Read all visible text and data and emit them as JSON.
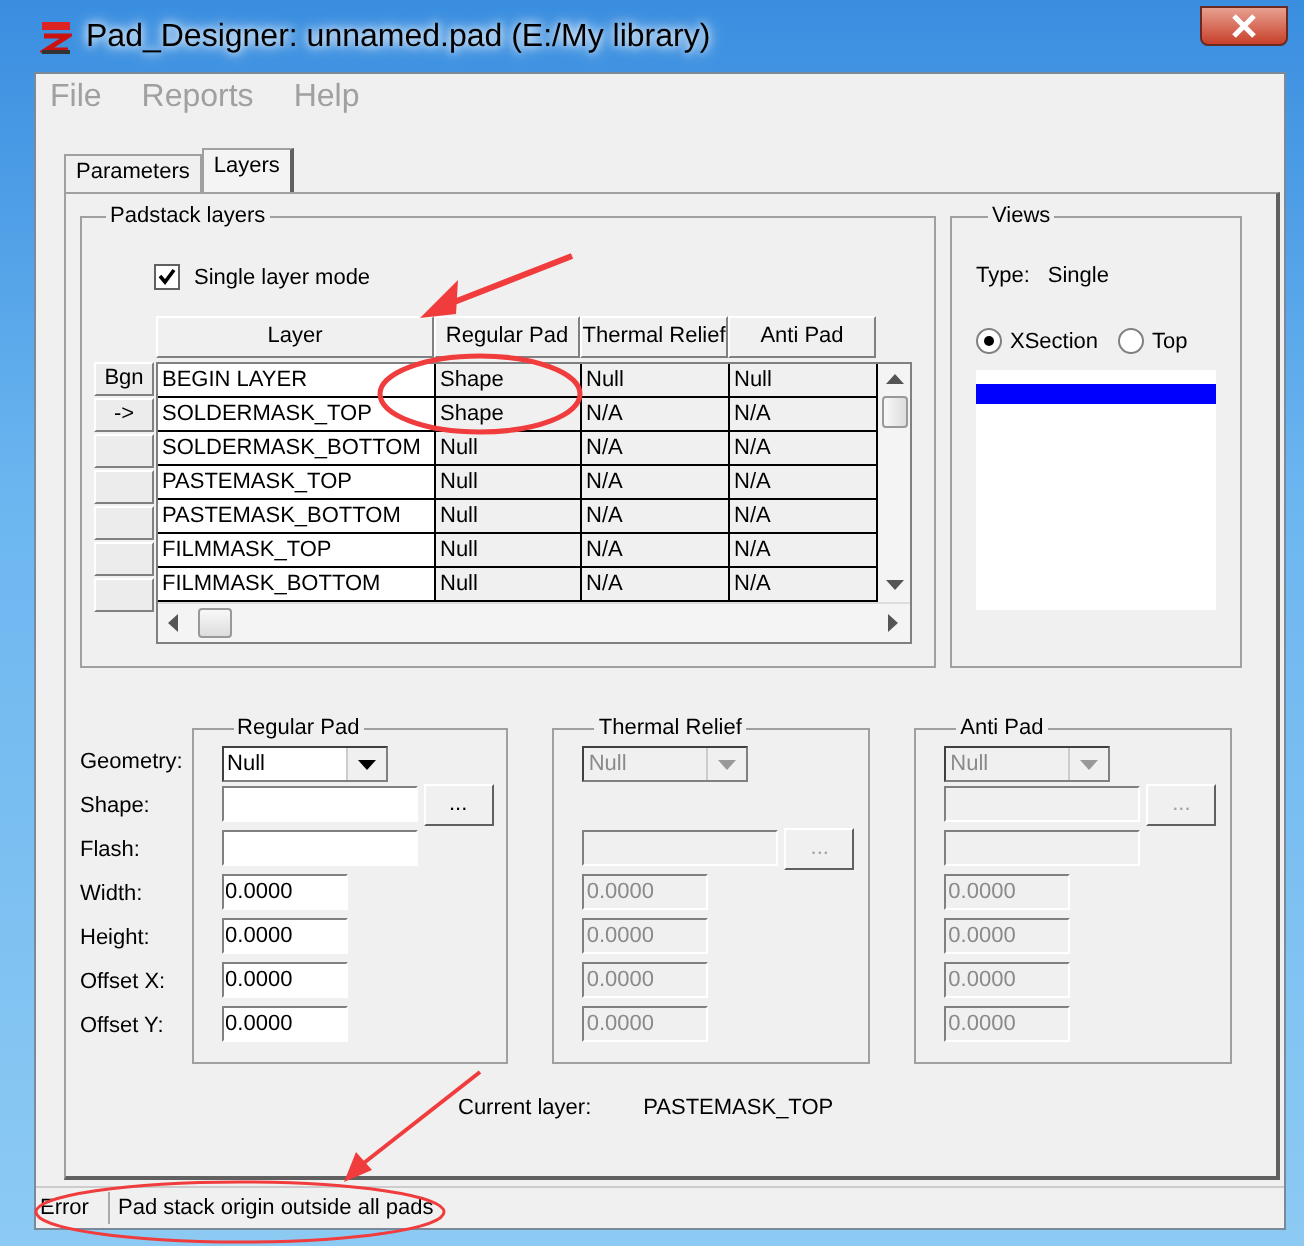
{
  "window": {
    "title": "Pad_Designer: unnamed.pad (E:/My library)"
  },
  "menu": [
    {
      "label": "File"
    },
    {
      "label": "Reports"
    },
    {
      "label": "Help"
    }
  ],
  "tabs": [
    {
      "label": "Parameters",
      "selected": false
    },
    {
      "label": "Layers",
      "selected": true
    }
  ],
  "padstack_layers": {
    "title": "Padstack layers",
    "single_layer_mode": {
      "label": "Single layer mode",
      "checked": true
    },
    "table": {
      "columns": [
        "Layer",
        "Regular Pad",
        "Thermal Relief",
        "Anti Pad"
      ],
      "rows": [
        {
          "marker": "Bgn",
          "cells": [
            "BEGIN LAYER",
            "Shape",
            "Null",
            "Null"
          ]
        },
        {
          "marker": "->",
          "cells": [
            "SOLDERMASK_TOP",
            "Shape",
            "N/A",
            "N/A"
          ]
        },
        {
          "cells": [
            "SOLDERMASK_BOTTOM",
            "Null",
            "N/A",
            "N/A"
          ]
        },
        {
          "cells": [
            "PASTEMASK_TOP",
            "Null",
            "N/A",
            "N/A"
          ]
        },
        {
          "cells": [
            "PASTEMASK_BOTTOM",
            "Null",
            "N/A",
            "N/A"
          ]
        },
        {
          "cells": [
            "FILMMASK_TOP",
            "Null",
            "N/A",
            "N/A"
          ]
        },
        {
          "cells": [
            "FILMMASK_BOTTOM",
            "Null",
            "N/A",
            "N/A"
          ]
        }
      ]
    }
  },
  "views": {
    "title": "Views",
    "type_label": "Type:",
    "type_value": "Single",
    "options": [
      {
        "label": "XSection",
        "selected": true
      },
      {
        "label": "Top",
        "selected": false
      }
    ]
  },
  "field_labels": [
    "Geometry:",
    "Shape:",
    "Flash:",
    "Width:",
    "Height:",
    "Offset X:",
    "Offset Y:"
  ],
  "pad_groups": [
    {
      "title": "Regular Pad",
      "disabled": false,
      "geometry": "Null",
      "fields": [
        {
          "kind": "text",
          "browse": "..."
        },
        {
          "kind": "text"
        },
        {
          "kind": "number",
          "value": "0.0000"
        },
        {
          "kind": "number",
          "value": "0.0000"
        },
        {
          "kind": "number",
          "value": "0.0000"
        },
        {
          "kind": "number",
          "value": "0.0000"
        }
      ]
    },
    {
      "title": "Thermal Relief",
      "disabled": true,
      "geometry": "Null",
      "fields": [
        {
          "kind": "blank"
        },
        {
          "kind": "text",
          "browse": "..."
        },
        {
          "kind": "number",
          "value": "0.0000"
        },
        {
          "kind": "number",
          "value": "0.0000"
        },
        {
          "kind": "number",
          "value": "0.0000"
        },
        {
          "kind": "number",
          "value": "0.0000"
        }
      ]
    },
    {
      "title": "Anti Pad",
      "disabled": true,
      "geometry": "Null",
      "fields": [
        {
          "kind": "text",
          "browse": "..."
        },
        {
          "kind": "text"
        },
        {
          "kind": "number",
          "value": "0.0000"
        },
        {
          "kind": "number",
          "value": "0.0000"
        },
        {
          "kind": "number",
          "value": "0.0000"
        },
        {
          "kind": "number",
          "value": "0.0000"
        }
      ]
    }
  ],
  "current_layer": {
    "label": "Current layer:",
    "value": "PASTEMASK_TOP"
  },
  "status_bar": {
    "level": "Error",
    "message": "Pad stack origin outside all pads"
  }
}
